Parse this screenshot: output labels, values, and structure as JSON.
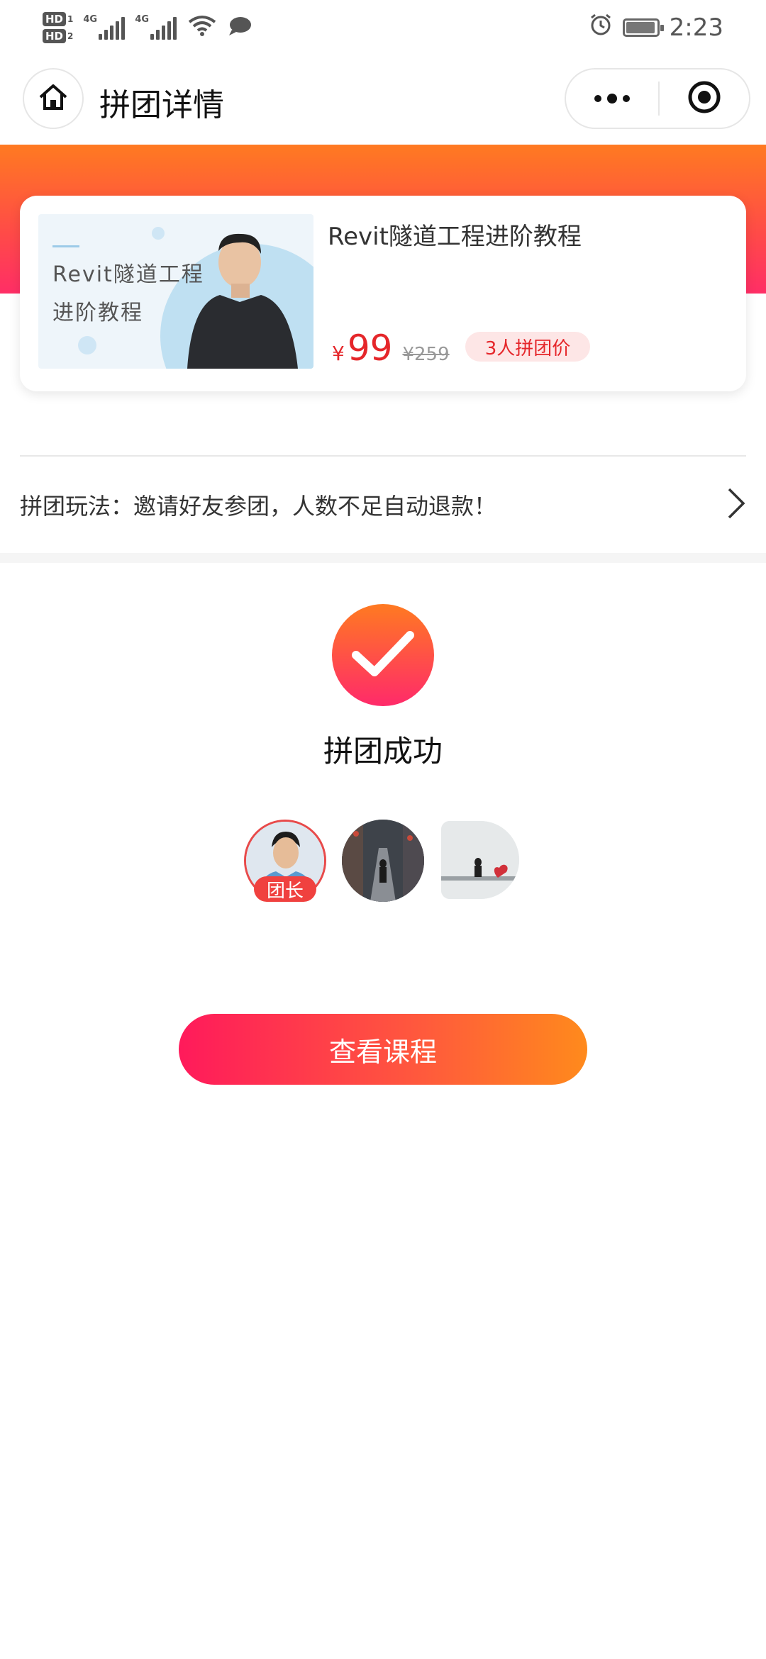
{
  "status_bar": {
    "time": "2:23",
    "left_icons": [
      "hd1-icon",
      "hd2-icon",
      "signal-4g-icon",
      "signal-4g-icon",
      "wifi-icon",
      "chat-bubble-icon"
    ],
    "right_icons": [
      "alarm-icon",
      "battery-charging-icon"
    ],
    "hd1": "HD",
    "hd1_num": "1",
    "hd2": "HD",
    "hd2_num": "2",
    "net1": "4G",
    "net2": "4G"
  },
  "nav": {
    "title": "拼团详情",
    "home_icon": "home-icon",
    "more_icon": "more-dots-icon",
    "close_icon": "target-icon"
  },
  "course": {
    "thumb_line1": "Revit隧道工程",
    "thumb_line2": "进阶教程",
    "title": "Revit隧道工程进阶教程",
    "currency": "¥",
    "price": "99",
    "original_price": "¥259",
    "group_badge": "3人拼团价"
  },
  "rules": {
    "text": "拼团玩法：邀请好友参团，人数不足自动退款！",
    "arrow_icon": "chevron-right-icon"
  },
  "result": {
    "icon": "check-circle-icon",
    "text": "拼团成功"
  },
  "members": {
    "leader_tag": "团长",
    "count": 3
  },
  "cta": {
    "label": "查看课程"
  },
  "colors": {
    "accent_red": "#e5262a",
    "gradient_start": "#ff1a5b",
    "gradient_end": "#ff8a1c",
    "banner_top": "#ff7a21"
  }
}
